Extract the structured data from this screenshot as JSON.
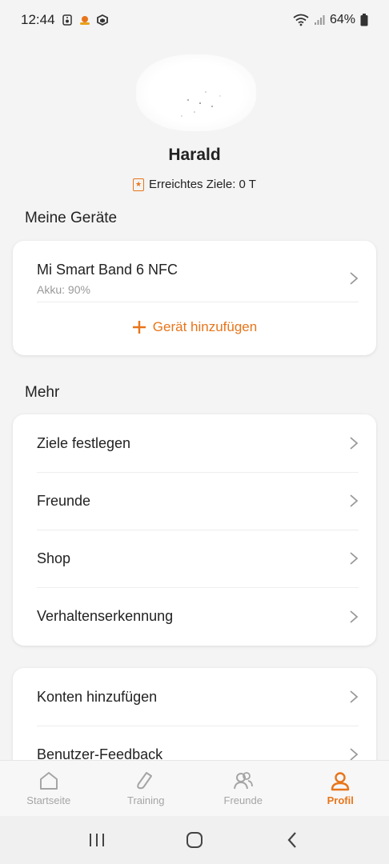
{
  "status_bar": {
    "time": "12:44",
    "battery": "64%"
  },
  "profile": {
    "name": "Harald",
    "goal_text": "Erreichtes Ziele: 0 T"
  },
  "devices_section": {
    "title": "Meine Geräte",
    "device_name": "Mi Smart Band 6 NFC",
    "device_battery": "Akku: 90%",
    "add_device_label": "Gerät hinzufügen"
  },
  "more_section": {
    "title": "Mehr",
    "items": [
      {
        "label": "Ziele festlegen"
      },
      {
        "label": "Freunde"
      },
      {
        "label": "Shop"
      },
      {
        "label": "Verhaltenserkennung"
      }
    ]
  },
  "accounts_section": {
    "items": [
      {
        "label": "Konten hinzufügen"
      },
      {
        "label": "Benutzer-Feedback"
      }
    ]
  },
  "bottom_nav": {
    "items": [
      {
        "label": "Startseite",
        "icon": "home-icon"
      },
      {
        "label": "Training",
        "icon": "shoe-icon"
      },
      {
        "label": "Freunde",
        "icon": "friends-icon"
      },
      {
        "label": "Profil",
        "icon": "profile-icon"
      }
    ],
    "active": "Profil"
  },
  "colors": {
    "accent": "#e8751a",
    "background": "#f4f4f4",
    "card": "#ffffff",
    "inactive": "#a5a5a5"
  }
}
